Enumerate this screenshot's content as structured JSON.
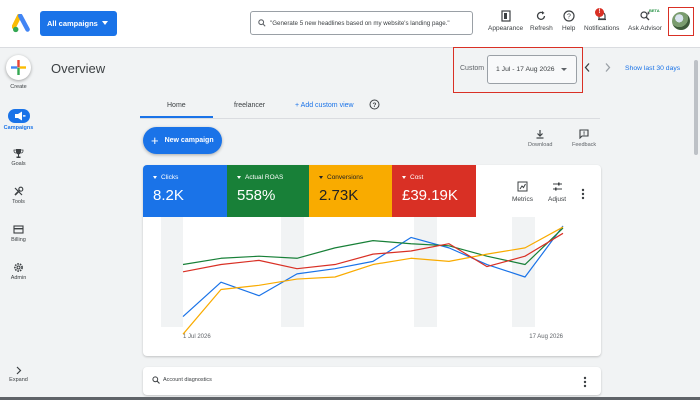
{
  "header": {
    "campaign_selector": "All campaigns",
    "search_placeholder": "\"Generate 5 new headlines based on my website's landing page.\"",
    "tools": [
      {
        "label": "Appearance",
        "icon": "appearance-icon"
      },
      {
        "label": "Refresh",
        "icon": "refresh-icon"
      },
      {
        "label": "Help",
        "icon": "help-icon"
      },
      {
        "label": "Notifications",
        "icon": "bell-icon",
        "badge": "!"
      },
      {
        "label": "Ask Advisor",
        "icon": "advisor-icon",
        "tag": "BETA"
      }
    ]
  },
  "sidebar": {
    "items": [
      {
        "label": "Create",
        "icon": "plus-icon"
      },
      {
        "label": "Campaigns",
        "icon": "megaphone-icon",
        "active": true
      },
      {
        "label": "Goals",
        "icon": "trophy-icon"
      },
      {
        "label": "Tools",
        "icon": "tools-icon"
      },
      {
        "label": "Billing",
        "icon": "billing-icon"
      },
      {
        "label": "Admin",
        "icon": "gear-icon"
      },
      {
        "label": "Expand",
        "icon": "chevron-right-icon"
      }
    ]
  },
  "page": {
    "title": "Overview",
    "date_range_label": "Custom",
    "date_range": "1 Jul - 17 Aug 2026",
    "show_last": "Show last 30 days"
  },
  "tabs": {
    "home": "Home",
    "freelancer": "freelancer",
    "add_view": "Add custom view"
  },
  "actions": {
    "new_campaign": "New campaign",
    "download": "Download",
    "feedback": "Feedback"
  },
  "metrics": [
    {
      "label": "Clicks",
      "value": "8.2K",
      "color": "#1a73e8"
    },
    {
      "label": "Actual ROAS",
      "value": "558%",
      "color": "#188038"
    },
    {
      "label": "Conversions",
      "value": "2.73K",
      "color": "#f9ab00"
    },
    {
      "label": "Cost",
      "value": "£39.19K",
      "color": "#d93025"
    }
  ],
  "card_tools": {
    "metrics": "Metrics",
    "adjust": "Adjust"
  },
  "chart_data": {
    "type": "line",
    "x_start_label": "1 Jul 2026",
    "x_end_label": "17 Aug 2026",
    "x": [
      0,
      1,
      2,
      3,
      4,
      5,
      6,
      7,
      8,
      9,
      10
    ],
    "series": [
      {
        "color": "#1a73e8",
        "values": [
          0.12,
          0.45,
          0.32,
          0.53,
          0.58,
          0.65,
          0.88,
          0.78,
          0.62,
          0.5,
          0.99
        ]
      },
      {
        "color": "#188038",
        "values": [
          0.62,
          0.68,
          0.7,
          0.68,
          0.78,
          0.85,
          0.82,
          0.8,
          0.7,
          0.62,
          0.97
        ]
      },
      {
        "color": "#f9ab00",
        "values": [
          -0.05,
          0.38,
          0.42,
          0.48,
          0.5,
          0.62,
          0.68,
          0.65,
          0.72,
          0.78,
          0.98
        ]
      },
      {
        "color": "#d93025",
        "values": [
          0.55,
          0.62,
          0.66,
          0.58,
          0.62,
          0.72,
          0.75,
          0.82,
          0.6,
          0.7,
          0.92
        ]
      }
    ],
    "grid": false,
    "highlight_bands": true,
    "legend": "none"
  },
  "diagnostics": {
    "label": "Account diagnostics"
  }
}
